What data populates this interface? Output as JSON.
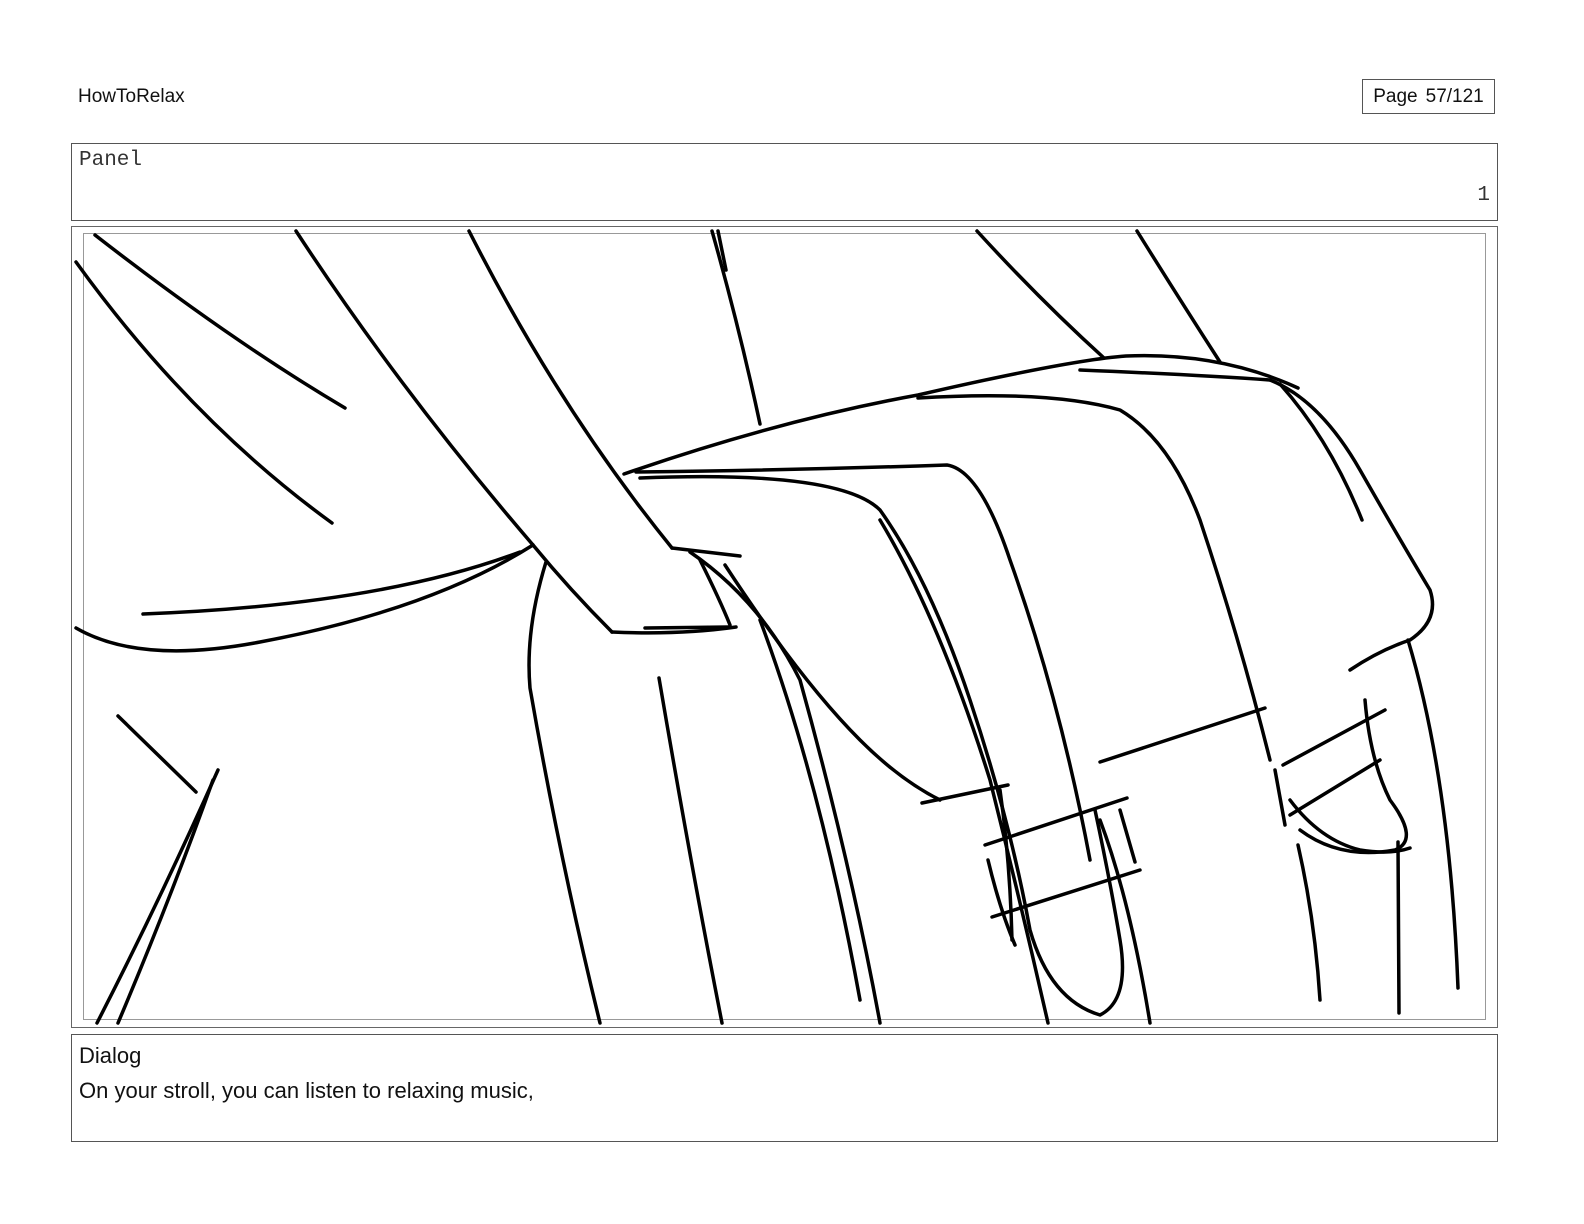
{
  "header": {
    "project_title": "HowToRelax",
    "page_label": "Page",
    "page_number": "57/121"
  },
  "panel": {
    "label": "Panel",
    "number": "1"
  },
  "dialog": {
    "label": "Dialog",
    "text": "On your stroll, you can listen to relaxing music,"
  }
}
